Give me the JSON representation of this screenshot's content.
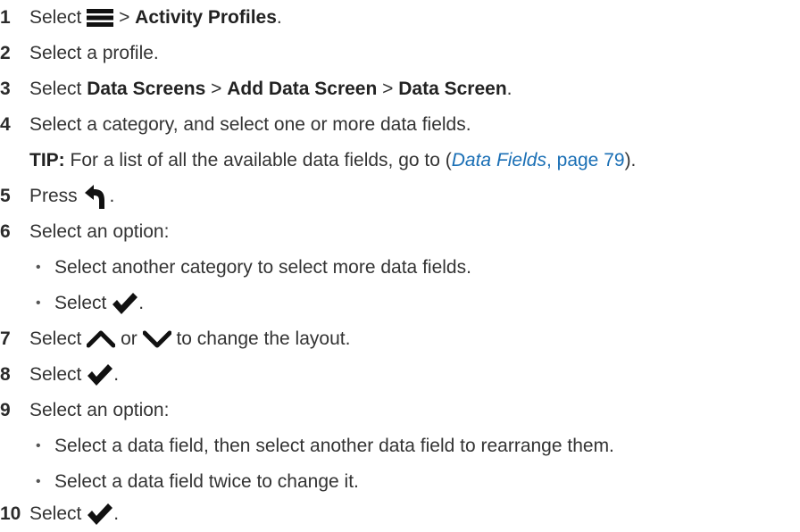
{
  "steps": [
    {
      "num": "1",
      "pre": "Select",
      "icon": "menu-icon",
      "sep": ">",
      "bold": "Activity Profiles",
      "end": "."
    },
    {
      "num": "2",
      "text": "Select a profile."
    },
    {
      "num": "3",
      "pre": "Select",
      "b1": "Data Screens",
      "s1": ">",
      "b2": "Add Data Screen",
      "s2": ">",
      "b3": "Data Screen",
      "end": "."
    },
    {
      "num": "4",
      "text": "Select a category, and select one or more data fields.",
      "tip_label": "TIP:",
      "tip_text": "For a list of all the available data fields, go to (",
      "tip_link": "Data Fields",
      "tip_link_rest": ", page 79",
      "tip_end": ")."
    },
    {
      "num": "5",
      "pre": "Press",
      "icon": "back-icon",
      "end": "."
    },
    {
      "num": "6",
      "text": "Select an option:",
      "bullets": [
        {
          "text": "Select another category to select more data fields."
        },
        {
          "pre": "Select",
          "icon": "check-icon",
          "end": "."
        }
      ]
    },
    {
      "num": "7",
      "pre": "Select",
      "icon1": "chevron-up-icon",
      "mid": "or",
      "icon2": "chevron-down-icon",
      "post": "to change the layout."
    },
    {
      "num": "8",
      "pre": "Select",
      "icon": "check-icon",
      "end": "."
    },
    {
      "num": "9",
      "text": "Select an option:",
      "bullets": [
        {
          "text": "Select a data field, then select another data field to rearrange them."
        },
        {
          "text": "Select a data field twice to change it."
        }
      ]
    },
    {
      "num": "10",
      "pre": "Select",
      "icon": "check-icon",
      "end": "."
    }
  ],
  "bullet_char": "•",
  "colors": {
    "text": "#333333",
    "link": "#1a6fb5",
    "icon": "#111111"
  }
}
